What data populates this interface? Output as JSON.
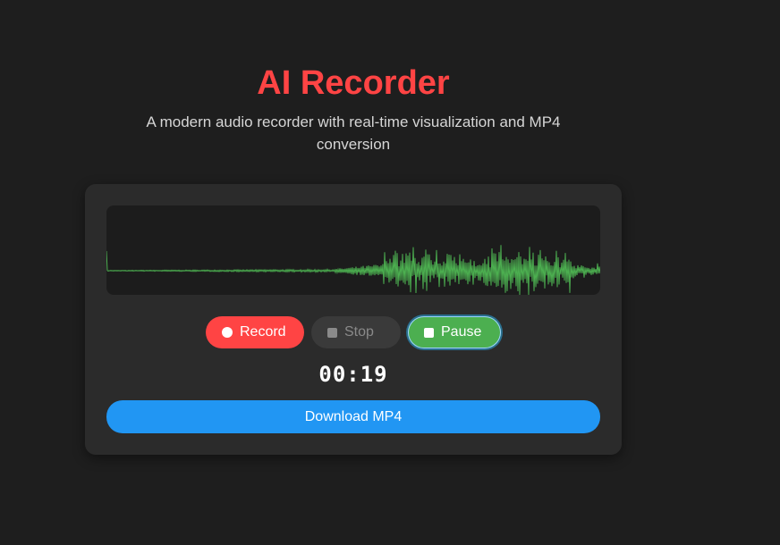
{
  "header": {
    "title": "AI Recorder",
    "subtitle": "A modern audio recorder with real-time visualization and MP4 conversion"
  },
  "colors": {
    "background": "#1e1e1e",
    "card": "#2b2b2b",
    "title": "#ff4444",
    "record": "#ff4444",
    "stop": "#3a3a3a",
    "pause": "#4caf50",
    "download": "#2196f3",
    "waveform": "#4caf50"
  },
  "controls": {
    "record_label": "Record",
    "stop_label": "Stop",
    "pause_label": "Pause",
    "record_icon": "record-dot-icon",
    "stop_icon": "stop-square-icon",
    "pause_icon": "pause-square-icon"
  },
  "timer": "00:19",
  "download_label": "Download MP4"
}
